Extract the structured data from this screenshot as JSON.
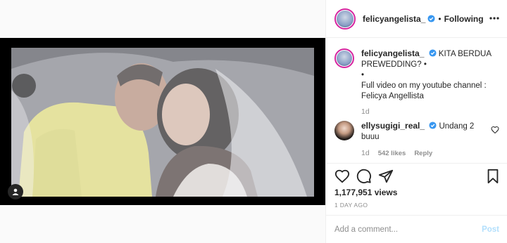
{
  "post": {
    "username": "felicyangelista_",
    "separator": "•",
    "follow_label": "Following"
  },
  "caption": {
    "username": "felicyangelista_",
    "line1": "KITA BERDUA",
    "line2": "PREWEDDING? •",
    "line3": "•",
    "line4": "Full video on my youtube channel :",
    "line5": "Felicya Angellista",
    "time": "1d"
  },
  "comment": {
    "username": "ellysugigi_real_",
    "text_line1": "Undang 2",
    "text_line2": "buuu",
    "time": "1d",
    "likes": "542 likes",
    "reply_label": "Reply"
  },
  "stats": {
    "views": "1,177,951 views",
    "ago": "1 DAY AGO"
  },
  "add_comment": {
    "placeholder": "Add a comment...",
    "post_label": "Post"
  },
  "icons": {
    "verified": "verified-badge-icon",
    "like": "heart-icon",
    "comment": "comment-bubble-icon",
    "share": "paper-plane-icon",
    "save": "bookmark-icon",
    "tagged": "tagged-user-icon"
  },
  "colors": {
    "accent_blue": "#3897f0",
    "post_button_disabled": "#b2dffc",
    "story_ring": "#d6249f"
  }
}
